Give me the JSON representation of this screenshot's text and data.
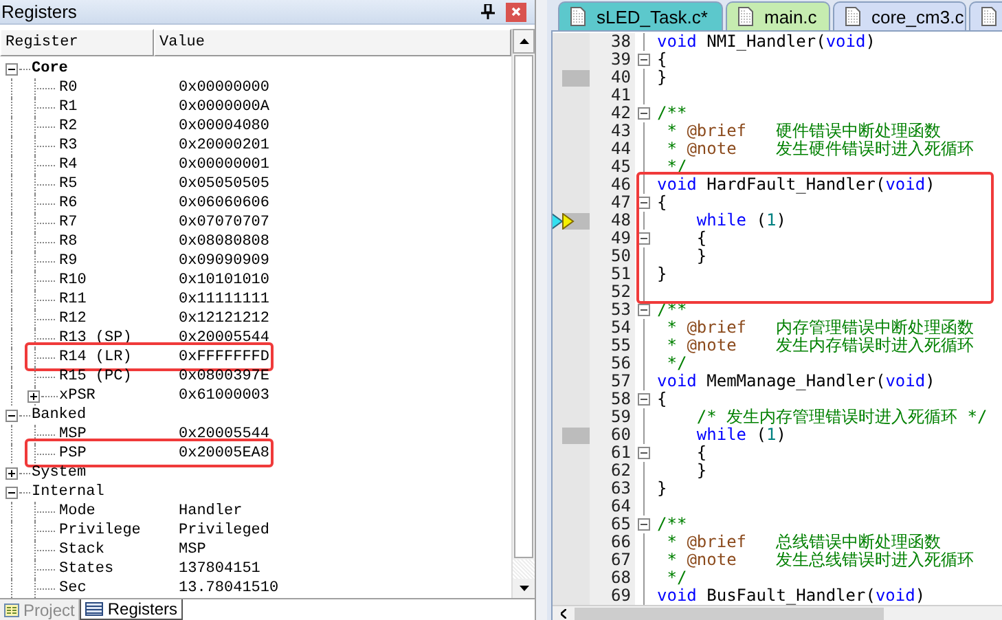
{
  "registers_panel": {
    "title": "Registers",
    "columns": [
      "Register",
      "Value"
    ],
    "groups": [
      {
        "label": "Core",
        "expanded": true,
        "bold": true,
        "rows": [
          {
            "name": "R0",
            "value": "0x00000000",
            "highlighted": false
          },
          {
            "name": "R1",
            "value": "0x0000000A",
            "highlighted": false
          },
          {
            "name": "R2",
            "value": "0x00004080",
            "highlighted": false
          },
          {
            "name": "R3",
            "value": "0x20000201",
            "highlighted": false
          },
          {
            "name": "R4",
            "value": "0x00000001",
            "highlighted": false
          },
          {
            "name": "R5",
            "value": "0x05050505",
            "highlighted": false
          },
          {
            "name": "R6",
            "value": "0x06060606",
            "highlighted": false
          },
          {
            "name": "R7",
            "value": "0x07070707",
            "highlighted": false
          },
          {
            "name": "R8",
            "value": "0x08080808",
            "highlighted": false
          },
          {
            "name": "R9",
            "value": "0x09090909",
            "highlighted": false
          },
          {
            "name": "R10",
            "value": "0x10101010",
            "highlighted": false
          },
          {
            "name": "R11",
            "value": "0x11111111",
            "highlighted": false
          },
          {
            "name": "R12",
            "value": "0x12121212",
            "highlighted": false
          },
          {
            "name": "R13 (SP)",
            "value": "0x20005544",
            "highlighted": false
          },
          {
            "name": "R14 (LR)",
            "value": "0xFFFFFFFD",
            "highlighted": true
          },
          {
            "name": "R15 (PC)",
            "value": "0x0800397E",
            "highlighted": false
          },
          {
            "name": "xPSR",
            "value": "0x61000003",
            "highlighted": false,
            "expanded": false
          }
        ]
      },
      {
        "label": "Banked",
        "expanded": true,
        "bold": false,
        "rows": [
          {
            "name": "MSP",
            "value": "0x20005544",
            "highlighted": false
          },
          {
            "name": "PSP",
            "value": "0x20005EA8",
            "highlighted": true
          }
        ]
      },
      {
        "label": "System",
        "expanded": false,
        "bold": false
      },
      {
        "label": "Internal",
        "expanded": true,
        "bold": false,
        "rows": [
          {
            "name": "Mode",
            "value": "Handler",
            "highlighted": false
          },
          {
            "name": "Privilege",
            "value": "Privileged",
            "highlighted": false
          },
          {
            "name": "Stack",
            "value": "MSP",
            "highlighted": false
          },
          {
            "name": "States",
            "value": "137804151",
            "highlighted": false
          },
          {
            "name": "Sec",
            "value": "13.78041510",
            "highlighted": false
          }
        ]
      }
    ],
    "bottom_tabs": [
      {
        "label": "Project",
        "selected": false
      },
      {
        "label": "Registers",
        "selected": true
      }
    ]
  },
  "editor": {
    "tabs": [
      {
        "label": "sLED_Task.c*",
        "color": "#5cc8cc"
      },
      {
        "label": "main.c",
        "color": "#c6ecb0"
      },
      {
        "label": "core_cm3.c",
        "color": "#d2ddf5"
      },
      {
        "color": "#d2ddf5"
      }
    ],
    "blocks": [
      {
        "boxed": false,
        "lines": [
          {
            "number": "38",
            "fold": false,
            "executed": false,
            "current": false,
            "segments": [
              {
                "kind": "keyword",
                "text": "void"
              },
              {
                "kind": "text",
                "text": " NMI_Handler("
              },
              {
                "kind": "keyword",
                "text": "void"
              },
              {
                "kind": "text",
                "text": ")"
              }
            ]
          },
          {
            "number": "39",
            "fold": true,
            "executed": false,
            "current": false,
            "segments": [
              {
                "kind": "text",
                "text": "{"
              }
            ]
          },
          {
            "number": "40",
            "fold": false,
            "executed": true,
            "current": false,
            "segments": [
              {
                "kind": "text",
                "text": "}"
              }
            ]
          },
          {
            "number": "41",
            "fold": false,
            "executed": false,
            "current": false
          },
          {
            "number": "42",
            "fold": true,
            "executed": false,
            "current": false,
            "segments": [
              {
                "kind": "comment",
                "text": "/**"
              }
            ]
          },
          {
            "number": "43",
            "fold": false,
            "executed": false,
            "current": false,
            "segments": [
              {
                "kind": "comment",
                "text": " * "
              },
              {
                "kind": "tag",
                "text": "@brief"
              },
              {
                "kind": "comment",
                "text": "   硬件错误中断处理函数"
              }
            ]
          },
          {
            "number": "44",
            "fold": false,
            "executed": false,
            "current": false,
            "segments": [
              {
                "kind": "comment",
                "text": " * "
              },
              {
                "kind": "tag",
                "text": "@note"
              },
              {
                "kind": "comment",
                "text": "    发生硬件错误时进入死循环"
              }
            ]
          },
          {
            "number": "45",
            "fold": false,
            "executed": false,
            "current": false,
            "segments": [
              {
                "kind": "comment",
                "text": " */"
              }
            ]
          }
        ]
      },
      {
        "boxed": true,
        "lines": [
          {
            "number": "46",
            "fold": false,
            "executed": false,
            "current": false,
            "segments": [
              {
                "kind": "keyword",
                "text": "void"
              },
              {
                "kind": "text",
                "text": " HardFault_Handler("
              },
              {
                "kind": "keyword",
                "text": "void"
              },
              {
                "kind": "text",
                "text": ")"
              }
            ]
          },
          {
            "number": "47",
            "fold": true,
            "executed": false,
            "current": false,
            "segments": [
              {
                "kind": "text",
                "text": "{"
              }
            ]
          },
          {
            "number": "48",
            "fold": false,
            "executed": true,
            "current": true,
            "segments": [
              {
                "kind": "keyword",
                "text": "    while"
              },
              {
                "kind": "text",
                "text": " ("
              },
              {
                "kind": "number",
                "text": "1"
              },
              {
                "kind": "text",
                "text": ")"
              }
            ]
          },
          {
            "number": "49",
            "fold": true,
            "executed": false,
            "current": false,
            "segments": [
              {
                "kind": "text",
                "text": "    {"
              }
            ]
          },
          {
            "number": "50",
            "fold": false,
            "executed": false,
            "current": false,
            "segments": [
              {
                "kind": "text",
                "text": "    }"
              }
            ]
          },
          {
            "number": "51",
            "fold": false,
            "executed": false,
            "current": false,
            "segments": [
              {
                "kind": "text",
                "text": "}"
              }
            ]
          },
          {
            "number": "52",
            "fold": false,
            "executed": false,
            "current": false
          }
        ]
      },
      {
        "boxed": false,
        "lines": [
          {
            "number": "53",
            "fold": true,
            "executed": false,
            "current": false,
            "segments": [
              {
                "kind": "comment",
                "text": "/**"
              }
            ]
          },
          {
            "number": "54",
            "fold": false,
            "executed": false,
            "current": false,
            "segments": [
              {
                "kind": "comment",
                "text": " * "
              },
              {
                "kind": "tag",
                "text": "@brief"
              },
              {
                "kind": "comment",
                "text": "   内存管理错误中断处理函数"
              }
            ]
          },
          {
            "number": "55",
            "fold": false,
            "executed": false,
            "current": false,
            "segments": [
              {
                "kind": "comment",
                "text": " * "
              },
              {
                "kind": "tag",
                "text": "@note"
              },
              {
                "kind": "comment",
                "text": "    发生内存错误时进入死循环"
              }
            ]
          },
          {
            "number": "56",
            "fold": false,
            "executed": false,
            "current": false,
            "segments": [
              {
                "kind": "comment",
                "text": " */"
              }
            ]
          },
          {
            "number": "57",
            "fold": false,
            "executed": false,
            "current": false,
            "segments": [
              {
                "kind": "keyword",
                "text": "void"
              },
              {
                "kind": "text",
                "text": " MemManage_Handler("
              },
              {
                "kind": "keyword",
                "text": "void"
              },
              {
                "kind": "text",
                "text": ")"
              }
            ]
          },
          {
            "number": "58",
            "fold": true,
            "executed": false,
            "current": false,
            "segments": [
              {
                "kind": "text",
                "text": "{"
              }
            ]
          },
          {
            "number": "59",
            "fold": false,
            "executed": false,
            "current": false,
            "segments": [
              {
                "kind": "comment",
                "text": "    /* 发生内存管理错误时进入死循环 */"
              }
            ]
          },
          {
            "number": "60",
            "fold": false,
            "executed": true,
            "current": false,
            "segments": [
              {
                "kind": "keyword",
                "text": "    while"
              },
              {
                "kind": "text",
                "text": " ("
              },
              {
                "kind": "number",
                "text": "1"
              },
              {
                "kind": "text",
                "text": ")"
              }
            ]
          },
          {
            "number": "61",
            "fold": true,
            "executed": false,
            "current": false,
            "segments": [
              {
                "kind": "text",
                "text": "    {"
              }
            ]
          },
          {
            "number": "62",
            "fold": false,
            "executed": false,
            "current": false,
            "segments": [
              {
                "kind": "text",
                "text": "    }"
              }
            ]
          },
          {
            "number": "63",
            "fold": false,
            "executed": false,
            "current": false,
            "segments": [
              {
                "kind": "text",
                "text": "}"
              }
            ]
          },
          {
            "number": "64",
            "fold": false,
            "executed": false,
            "current": false
          },
          {
            "number": "65",
            "fold": true,
            "executed": false,
            "current": false,
            "segments": [
              {
                "kind": "comment",
                "text": "/**"
              }
            ]
          },
          {
            "number": "66",
            "fold": false,
            "executed": false,
            "current": false,
            "segments": [
              {
                "kind": "comment",
                "text": " * "
              },
              {
                "kind": "tag",
                "text": "@brief"
              },
              {
                "kind": "comment",
                "text": "   总线错误中断处理函数"
              }
            ]
          },
          {
            "number": "67",
            "fold": false,
            "executed": false,
            "current": false,
            "segments": [
              {
                "kind": "comment",
                "text": " * "
              },
              {
                "kind": "tag",
                "text": "@note"
              },
              {
                "kind": "comment",
                "text": "    发生总线错误时进入死循环"
              }
            ]
          },
          {
            "number": "68",
            "fold": false,
            "executed": false,
            "current": false,
            "segments": [
              {
                "kind": "comment",
                "text": " */"
              }
            ]
          },
          {
            "number": "69",
            "fold": false,
            "executed": false,
            "current": false,
            "segments": [
              {
                "kind": "keyword",
                "text": "void"
              },
              {
                "kind": "text",
                "text": " BusFault_Handler("
              },
              {
                "kind": "keyword",
                "text": "void"
              },
              {
                "kind": "text",
                "text": ")"
              }
            ]
          }
        ]
      }
    ]
  }
}
